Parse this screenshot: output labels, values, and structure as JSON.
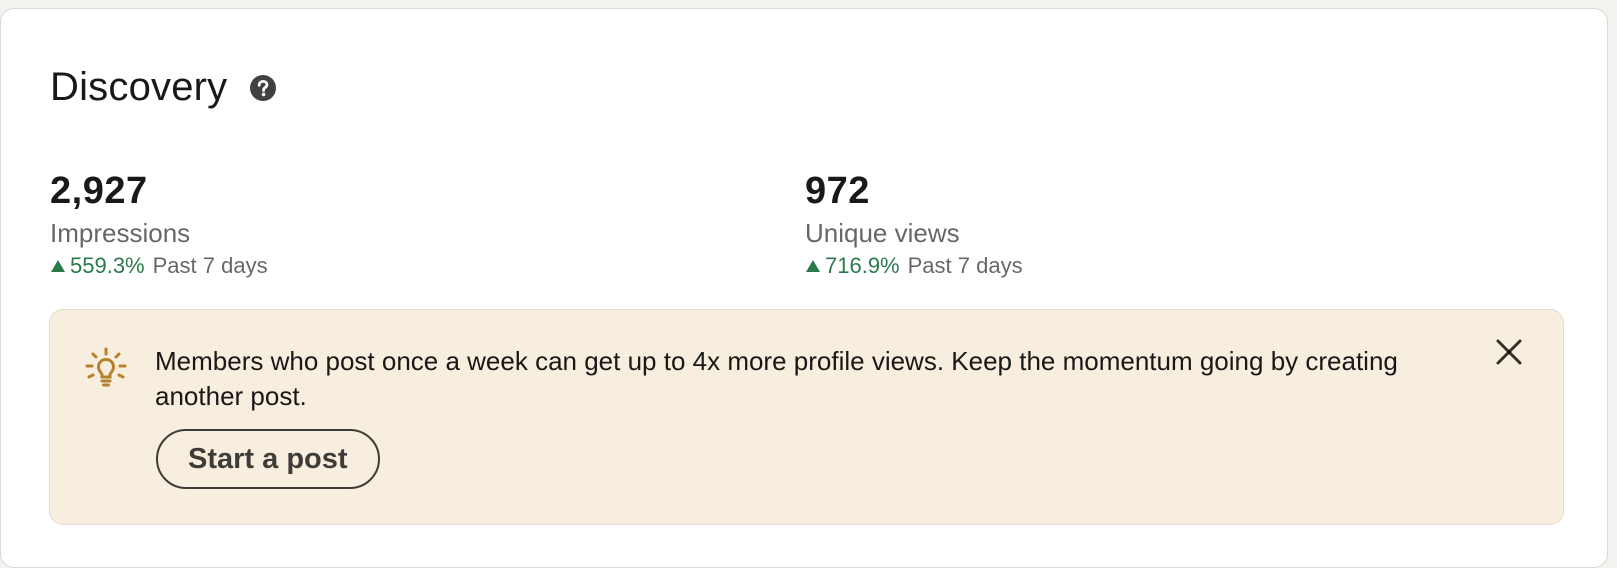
{
  "header": {
    "title": "Discovery",
    "help_icon": "help-circle-icon"
  },
  "metrics": [
    {
      "value": "2,927",
      "label": "Impressions",
      "trend": "559.3%",
      "trend_direction": "up",
      "period": "Past 7 days"
    },
    {
      "value": "972",
      "label": "Unique views",
      "trend": "716.9%",
      "trend_direction": "up",
      "period": "Past 7 days"
    }
  ],
  "tip": {
    "icon": "lightbulb-icon",
    "text": "Members who post once a week can get up to 4x more profile views. Keep the momentum going by creating another post.",
    "button_label": "Start a post",
    "close_icon": "close-icon"
  },
  "colors": {
    "trend_positive": "#2b7a4b",
    "tip_background": "#f8eedf",
    "bulb": "#b5812a"
  }
}
